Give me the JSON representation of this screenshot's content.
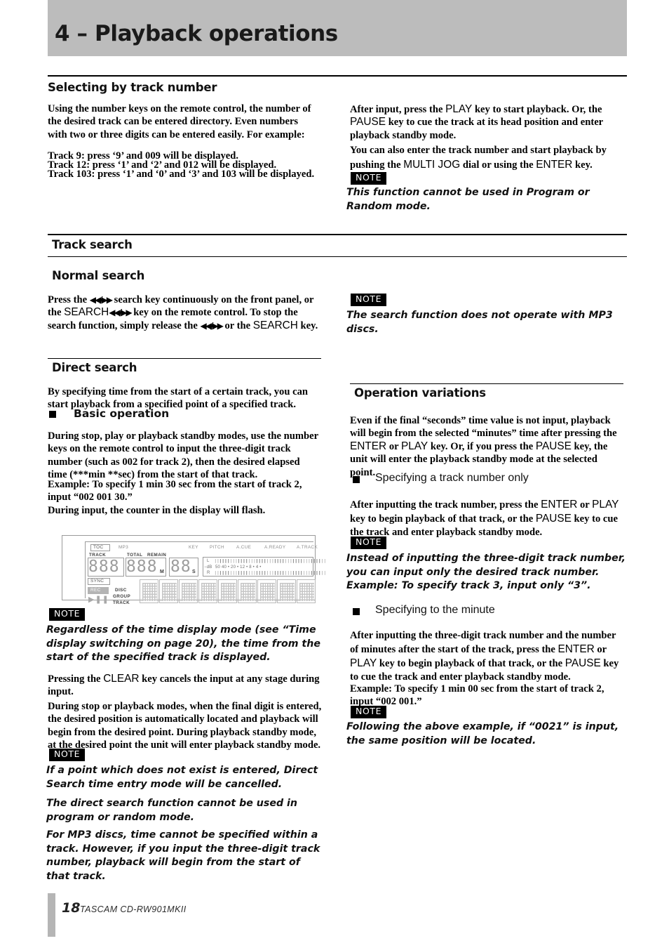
{
  "chapter": {
    "title": "4 – Playback operations"
  },
  "sections": {
    "selecting_by_track_number": {
      "heading": "Selecting by track number",
      "left_p1": "Using the number keys on the remote control, the number of the desired track can be entered directory. Even numbers with two or three digits can be entered easily. For example:",
      "left_examples": [
        "Track 9:  press ‘9’ and 009 will be displayed.",
        "Track 12:  press ‘1’ and ‘2’ and 012 will be displayed.",
        "Track 103:  press ‘1’ and ‘0’ and ‘3’ and 103 will be displayed."
      ],
      "right_p1_a": "After input, press the ",
      "right_p1_key1": "PLAY",
      "right_p1_b": " key to start playback. Or, the ",
      "right_p1_key2": "PAUSE",
      "right_p1_c": " key to cue the track at its head position and enter playback standby mode.",
      "right_p2_a": "You can also enter the track number and start playback  by pushing the ",
      "right_p2_key1": "MULTI JOG",
      "right_p2_b": " dial or using the ",
      "right_p2_key2": "ENTER",
      "right_p2_c": " key.",
      "note_label": "NOTE",
      "note_text": "This function cannot be used in Program or Random mode."
    },
    "track_search": {
      "heading": "Track search"
    },
    "normal_search": {
      "heading": "Normal search",
      "left_p1_a": "Press the ",
      "left_p1_arrows1": "◀◀/▶▶",
      "left_p1_b": " search key continuously on the front panel, or the ",
      "left_p1_key1": "SEARCH",
      "left_p1_arrows2": "◀◀/▶▶",
      "left_p1_c": " key on the remote control. To stop the search function, simply release the ",
      "left_p1_arrows3": "◀◀/▶▶",
      "left_p1_d": " or the ",
      "left_p1_key2": "SEARCH",
      "left_p1_e": " key.",
      "note_label": "NOTE",
      "note_text": "The search function does not operate with MP3 discs."
    },
    "direct_search": {
      "heading": "Direct search",
      "p1": "By specifying time from the start of a certain track, you can start playback from a specified point of a specified track.",
      "subhead_basic": "Basic operation",
      "p2": "During stop, play or playback standby modes, use the number keys on the remote control to input the three-digit track number (such as 002 for track 2), then the desired elapsed time (***min **sec) from the start of that track.",
      "p3": "Example: To specify 1 min 30 sec from the start of track 2, input “002 001 30.”",
      "p4": "During input, the counter in the display will flash.",
      "note1_label": "NOTE",
      "note1_text": "Regardless of the time display mode (see “Time display switching on page 20), the time from the start of the specified track is displayed.",
      "p5_a": "Pressing the ",
      "p5_key": "CLEAR",
      "p5_b": " key cancels the input at any stage during input.",
      "p6": "During stop or playback modes, when the final digit is entered, the desired position is automatically located and playback will begin from the desired point. During playback standby mode, at the desired point the unit will enter playback standby mode.",
      "note2_label": "NOTE",
      "note2_text": "If a point which does not exist is entered, Direct Search time entry mode will be cancelled.",
      "note3_text": "The direct search function cannot be used in program or random mode.",
      "note4_text": "For MP3 discs, time cannot be specified within a track. However, if you input the three-digit track number, playback will begin from the start of that track."
    },
    "operation_variations": {
      "heading": "Operation variations",
      "p1_a": "Even if the final “seconds” time value is not input, playback will begin from the selected “minutes” time after pressing the ",
      "p1_key1": "ENTER",
      "p1_b": " or ",
      "p1_key2": "PLAY",
      "p1_c": " key. Or, if you press the ",
      "p1_key3": "PAUSE",
      "p1_d": " key, the unit will enter the playback standby mode at the selected point.",
      "subhead_track_only": "Specifying a track number only",
      "p2_a": "After inputting the track number, press the ",
      "p2_key1": "ENTER",
      "p2_b": " or ",
      "p2_key2": "PLAY",
      "p2_c": " key to begin playback of that track, or the ",
      "p2_key3": "PAUSE",
      "p2_d": " key to cue the track and enter playback standby mode.",
      "note1_label": "NOTE",
      "note1_text": "Instead of inputting the three-digit track number, you can input only the desired track number.",
      "note1_text2": "Example: To specify track 3, input only “3”.",
      "subhead_minute": "Specifying to the minute",
      "p3_a": "After inputting the three-digit track number and the number of minutes after the start of the track, press the ",
      "p3_key1": "ENTER",
      "p3_b": " or ",
      "p3_key2": "PLAY",
      "p3_c": " key to begin playback of that track, or the ",
      "p3_key3": "PAUSE",
      "p3_d": " key to cue the track and enter playback standby mode.",
      "p4": "Example: To specify 1 min 00 sec from the start of track 2, input “002 001.”",
      "note2_label": "NOTE",
      "note2_text": "Following the above example, if “0021” is input, the same position will be located."
    }
  },
  "lcd_figure": {
    "toc": "TOC",
    "mp3": "MP3",
    "track": "TRACK",
    "total": "TOTAL",
    "remain": "REMAIN",
    "sync": "SYNC",
    "rec": "REC",
    "disc": "DISC",
    "group": "GROUP",
    "track_small": "TRACK",
    "key": "KEY",
    "pitch": "PITCH",
    "a_cue": "A.CUE",
    "a_ready": "A.READY",
    "a_track": "A.TRACK",
    "digits_track": "888",
    "digits_min": "888",
    "digits_sec": "88",
    "unit_m": "M",
    "unit_s": "S",
    "meter_l": "L",
    "meter_r": "R",
    "meter_db": "−dB",
    "meter_scale": "50 40  •   20  •  12  •   8   •   4   •",
    "meter_bars": "❘❘❙❙❙❙❘❘❘❙❙❙❙❘❘❘❙❙❙❙❘❘❘❙❙❙❙❘❘❘❙❙❙❙❘❘❘❙❙❙❙❘❘",
    "play_pause": "▶❚❚"
  },
  "footer": {
    "page": "18",
    "model": "TASCAM  CD-RW901MKII"
  },
  "colors": {
    "header_bg": "#bcbcbc",
    "note_bg": "#000000",
    "lcd_gray": "#9d9d9d",
    "footer_bar": "#b5b5b5"
  }
}
